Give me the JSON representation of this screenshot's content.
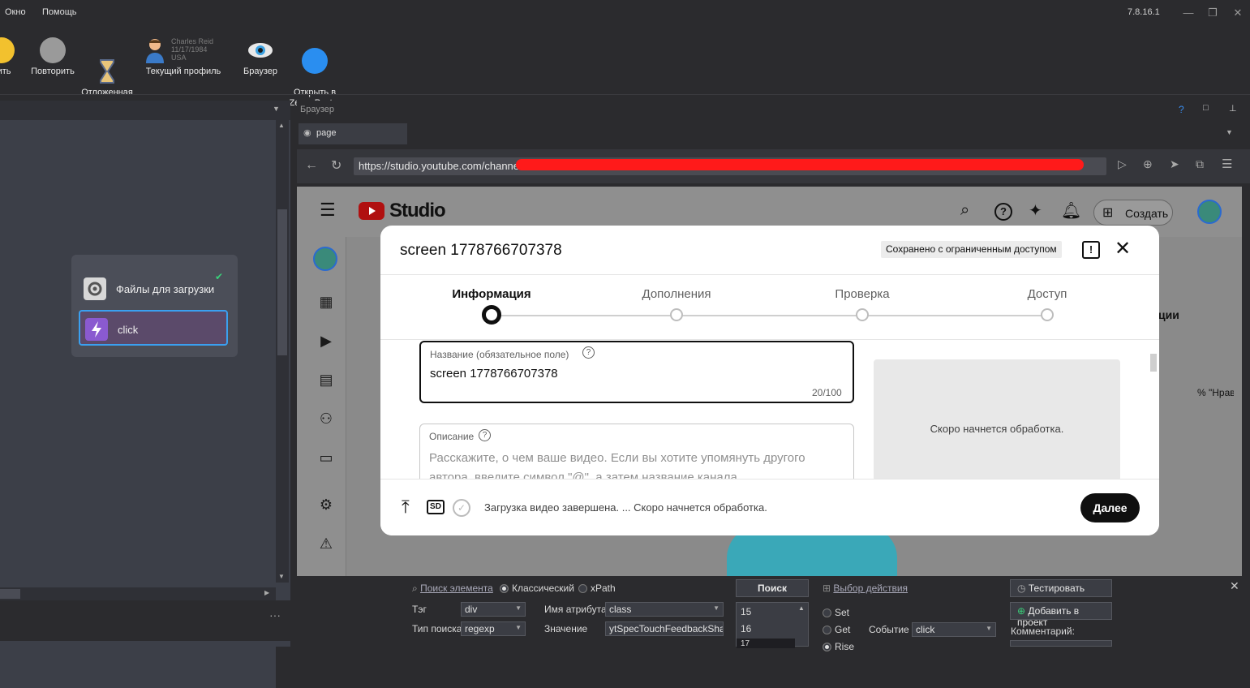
{
  "menu": {
    "items": [
      "Окно",
      "Помощь"
    ],
    "version": "7.8.16.1"
  },
  "toolbar": {
    "items": [
      {
        "label": "нить",
        "icon": "yellow-circle-icon"
      },
      {
        "label": "Повторить",
        "icon": "repeat-icon"
      },
      {
        "label": "Отложенная\nотрисовка",
        "icon": "hourglass-icon"
      },
      {
        "label": "Текущий профиль",
        "icon": "profile-icon"
      },
      {
        "label": "Браузер",
        "icon": "eye-icon"
      },
      {
        "label": "Открыть в\nZennoPoster",
        "icon": "zennoposter-icon"
      }
    ],
    "profile_info": [
      "Charles Reid",
      "11/17/1984",
      "USA"
    ]
  },
  "nodes": {
    "files": "Файлы для загрузки",
    "click": "click"
  },
  "browser": {
    "title": "Браузер",
    "tab_label": "page",
    "url": "https://studio.youtube.com/channe"
  },
  "yt": {
    "logo_text": "Studio",
    "create_label": "Создать",
    "right_col_text": "ции",
    "likes_text": "% \"Нрав"
  },
  "dialog": {
    "title": "screen 1778766707378",
    "badge": "Сохранено с ограниченным доступом",
    "steps": [
      "Информация",
      "Дополнения",
      "Проверка",
      "Доступ"
    ],
    "title_field": {
      "label": "Название (обязательное поле)",
      "value": "screen 1778766707378",
      "counter": "20/100"
    },
    "desc_field": {
      "label": "Описание",
      "placeholder": "Расскажите, о чем ваше видео. Если вы хотите упомянуть другого автора, введите символ \"@\", а затем название канала."
    },
    "preview_text": "Скоро начнется обработка.",
    "status": "Загрузка видео завершена. ... Скоро начнется обработка.",
    "sd_label": "SD",
    "next_label": "Далее"
  },
  "bottom": {
    "search_link": "Поиск элемента",
    "radio_classic": "Классический",
    "radio_xpath": "xPath",
    "tag_label": "Тэг",
    "tag_value": "div",
    "search_type_label": "Тип поиска",
    "search_type_value": "regexp",
    "attr_label": "Имя атрибута",
    "attr_value": "class",
    "value_label": "Значение",
    "value_value": "ytSpecTouchFeedbackShape",
    "search_button": "Поиск",
    "list": [
      "15",
      "16",
      "17"
    ],
    "action_link": "Выбор действия",
    "set": "Set",
    "get": "Get",
    "rise": "Rise",
    "event_label": "Событие",
    "event_value": "click",
    "test_button": "Тестировать",
    "add_button": "Добавить в проект",
    "comment_label": "Комментарий:"
  }
}
